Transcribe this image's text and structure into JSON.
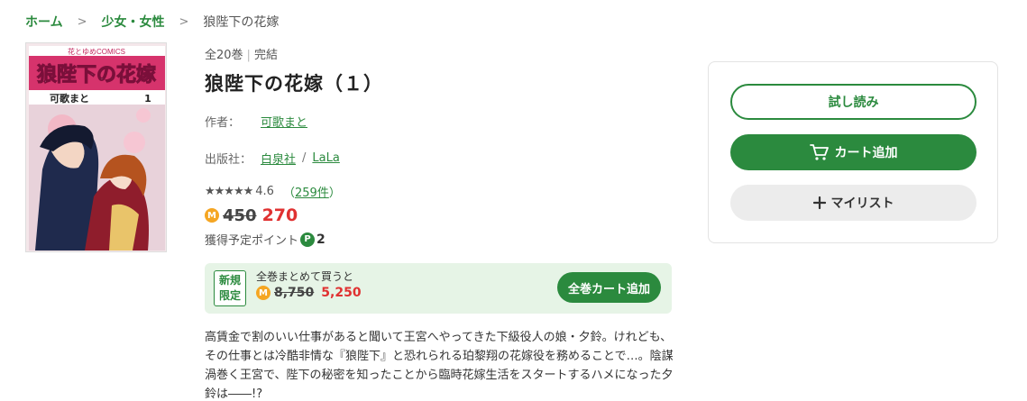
{
  "breadcrumb": {
    "home": "ホーム",
    "category": "少女・女性",
    "current": "狼陛下の花嫁"
  },
  "cover": {
    "label": "花とゆめCOMICS",
    "title": "狼陛下の花嫁",
    "author": "可歌まと",
    "volume": "1"
  },
  "book": {
    "volumes": "全20巻",
    "status": "完結",
    "title": "狼陛下の花嫁（１）",
    "author_label": "作者：",
    "author": "可歌まと",
    "publisher_label": "出版社：",
    "publisher": "白泉社",
    "label_name": "LaLa",
    "stars": "★★★★★",
    "rating": "4.6",
    "review_count": "259件",
    "coin_icon": "M",
    "original_price": "450",
    "sale_price": "270",
    "points_label": "獲得予定ポイント",
    "point_icon": "P",
    "points": "2",
    "description": "高賃金で割のいい仕事があると聞いて王宮へやってきた下級役人の娘・夕鈴。けれども、その仕事とは冷酷非情な『狼陛下』と恐れられる珀黎翔の花嫁役を務めることで…。陰謀渦巻く王宮で、陛下の秘密を知ったことから臨時花嫁生活をスタートするハメになった夕鈴は――!?"
  },
  "bundle": {
    "tag_line1": "新規",
    "tag_line2": "限定",
    "text": "全巻まとめて買うと",
    "original_price": "8,750",
    "sale_price": "5,250",
    "button": "全巻カート追加"
  },
  "actions": {
    "trial": "試し読み",
    "cart": "カート追加",
    "mylist": "マイリスト"
  },
  "colors": {
    "accent": "#2b8a3e",
    "sale": "#e03131",
    "coin": "#f5a623"
  }
}
